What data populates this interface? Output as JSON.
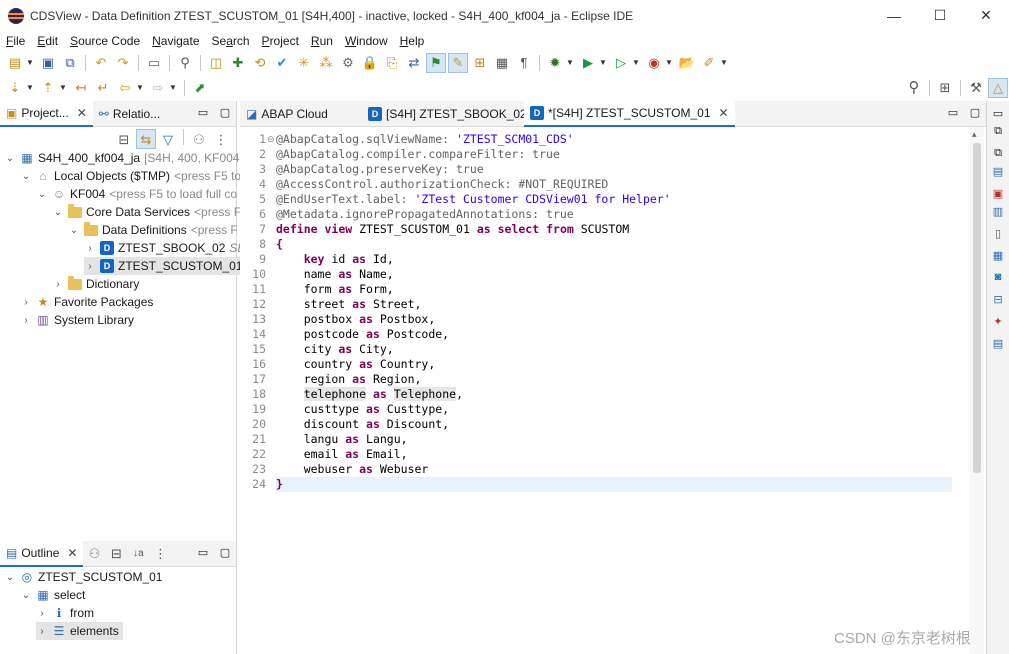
{
  "window": {
    "title": "CDSView - Data Definition ZTEST_SCUSTOM_01 [S4H,400] - inactive, locked - S4H_400_kf004_ja - Eclipse IDE",
    "minimize": "—",
    "maximize": "☐",
    "close": "✕"
  },
  "menu": [
    {
      "mn": "F",
      "rest": "ile"
    },
    {
      "mn": "E",
      "rest": "dit"
    },
    {
      "mn": "S",
      "rest": "ource Code"
    },
    {
      "mn": "N",
      "rest": "avigate"
    },
    {
      "mn": "",
      "rest": "Se",
      "mn2": "a",
      "rest2": "rch"
    },
    {
      "mn": "P",
      "rest": "roject"
    },
    {
      "mn": "R",
      "rest": "un"
    },
    {
      "mn": "W",
      "rest": "indow"
    },
    {
      "mn": "H",
      "rest": "elp"
    }
  ],
  "left_panel": {
    "tabs": [
      {
        "label": "Project...",
        "close": "✕",
        "icon": "project-explorer-icon"
      },
      {
        "label": "Relatio...",
        "icon": "relations-icon"
      }
    ],
    "tree": [
      {
        "label": "S4H_400_kf004_ja",
        "hint": "[S4H, 400, KF004, JA",
        "icon": "abap-project-icon"
      },
      {
        "label": "Local Objects ($TMP)",
        "hint": "<press F5 to",
        "icon": "local-objects-icon"
      },
      {
        "label": "KF004",
        "hint": "<press F5 to load full co",
        "icon": "user-icon"
      },
      {
        "label": "Core Data Services",
        "hint": "<press F5",
        "icon": "folder-icon"
      },
      {
        "label": "Data Definitions",
        "hint": "<press F",
        "icon": "folder-icon"
      },
      {
        "label": "ZTEST_SBOOK_02",
        "hint": "SB",
        "icon": "data-definition-icon"
      },
      {
        "label": "ZTEST_SCUSTOM_01",
        "hint": "",
        "icon": "data-definition-icon"
      },
      {
        "label": "Dictionary",
        "hint": "",
        "icon": "folder-icon"
      },
      {
        "label": "Favorite Packages",
        "hint": "",
        "icon": "favorite-packages-icon"
      },
      {
        "label": "System Library",
        "hint": "",
        "icon": "system-library-icon"
      }
    ]
  },
  "outline": {
    "tab_label": "Outline",
    "tab_close": "✕",
    "tree": [
      {
        "label": "ZTEST_SCUSTOM_01"
      },
      {
        "label": "select"
      },
      {
        "label": "from"
      },
      {
        "label": "elements"
      }
    ]
  },
  "editor": {
    "tabs": [
      {
        "label": "ABAP Cloud"
      },
      {
        "label": "[S4H] ZTEST_SBOOK_02"
      },
      {
        "label": "*[S4H] ZTEST_SCUSTOM_01",
        "close": "✕"
      }
    ],
    "line_numbers": [
      "1",
      "2",
      "3",
      "4",
      "5",
      "6",
      "7",
      "8",
      "9",
      "10",
      "11",
      "12",
      "13",
      "14",
      "15",
      "16",
      "17",
      "18",
      "19",
      "20",
      "21",
      "22",
      "23",
      "24"
    ],
    "code": [
      "@AbapCatalog.sqlViewName: 'ZTEST_SCM01_CDS'",
      "@AbapCatalog.compiler.compareFilter: true",
      "@AbapCatalog.preserveKey: true",
      "@AccessControl.authorizationCheck: #NOT_REQUIRED",
      "@EndUserText.label: 'ZTest Customer CDSView01 for Helper'",
      "@Metadata.ignorePropagatedAnnotations: true",
      "define view ZTEST_SCUSTOM_01 as select from SCUSTOM",
      "{",
      "    key id as Id,",
      "    name as Name,",
      "    form as Form,",
      "    street as Street,",
      "    postbox as Postbox,",
      "    postcode as Postcode,",
      "    city as City,",
      "    country as Country,",
      "    region as Region,",
      "    telephone as Telephone,",
      "    custtype as Custtype,",
      "    discount as Discount,",
      "    langu as Langu,",
      "    email as Email,",
      "    webuser as Webuser",
      "}"
    ]
  },
  "watermark": "CSDN @东京老树根",
  "colors": {
    "keyword": "#7f0055",
    "string": "#2a00ff",
    "annotation": "#646464",
    "selection_tab": "#1f6fc0"
  }
}
